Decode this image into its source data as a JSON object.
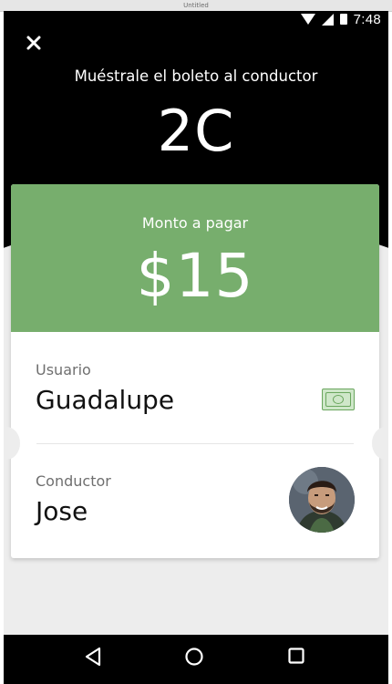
{
  "window": {
    "title": "Untitled"
  },
  "status_bar": {
    "time": "7:48",
    "icons": [
      "wifi-icon",
      "signal-icon",
      "battery-icon"
    ]
  },
  "header": {
    "close_icon": "close-icon",
    "instruction": "Muéstrale el boleto al conductor",
    "seat": "2C"
  },
  "payment": {
    "label": "Monto a pagar",
    "amount": "$15"
  },
  "user": {
    "label": "Usuario",
    "name": "Guadalupe",
    "payment_icon": "cash-icon"
  },
  "driver": {
    "label": "Conductor",
    "name": "Jose",
    "photo_icon": "driver-avatar"
  },
  "nav": {
    "icons": [
      "back-icon",
      "home-icon",
      "recent-apps-icon"
    ]
  },
  "colors": {
    "hero_background": "#000000",
    "payment_green": "#77ae6d",
    "card_background": "#ffffff",
    "page_background": "#ededed"
  }
}
